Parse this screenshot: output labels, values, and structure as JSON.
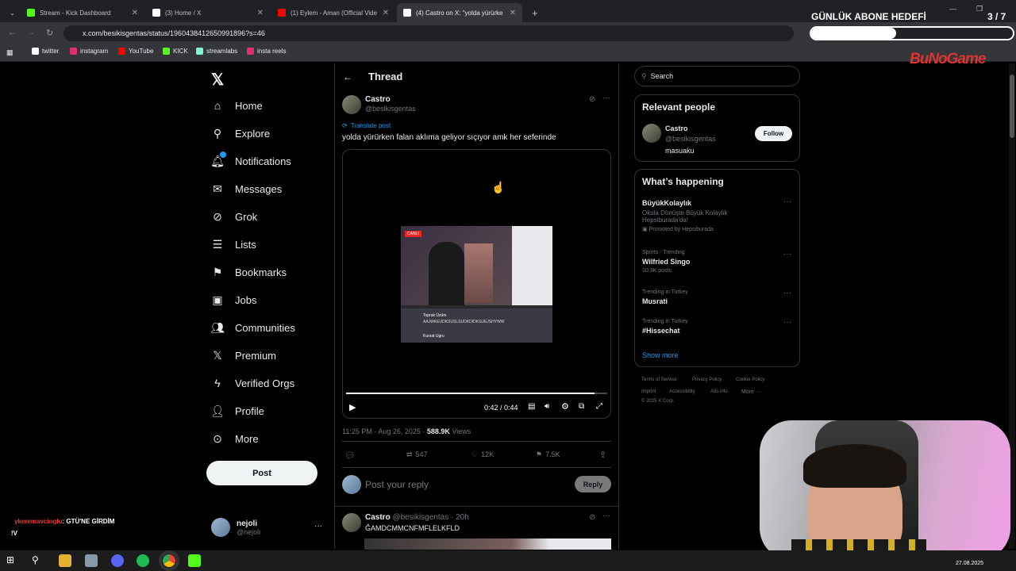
{
  "browser": {
    "tabs": [
      {
        "title": "Stream - Kick Dashboard",
        "color": "#53fc18"
      },
      {
        "title": "(3) Home / X",
        "color": "#ffffff"
      },
      {
        "title": "(1) Eylem - Aman (Official Vide",
        "color": "#ff0000"
      },
      {
        "title": "(4) Castro on X: \"yolda yürürke",
        "color": "#ffffff"
      }
    ],
    "url": "x.com/besikisgentas/status/1960438412650991896?s=46",
    "bookmarks": [
      "twitter",
      "instagram",
      "YouTube",
      "KICK",
      "streamlabs",
      "insta reels"
    ]
  },
  "overlay": {
    "goal_title": "GÜNLÜK ABONE HEDEFİ",
    "goal_count": "3 / 7",
    "brand": "BuNoGame",
    "chat_user": "ykeremavcioglu",
    "chat_text": ": GTÜ'NE GİRDİM",
    "chat_text2": "!V"
  },
  "nav": {
    "items": [
      "Home",
      "Explore",
      "Notifications",
      "Messages",
      "Grok",
      "Lists",
      "Bookmarks",
      "Jobs",
      "Communities",
      "Premium",
      "Verified Orgs",
      "Profile",
      "More"
    ],
    "post_label": "Post",
    "user_name": "nejoli",
    "user_handle": "@nejoli"
  },
  "thread": {
    "header": "Thread",
    "author": "Castro",
    "handle": "@besikisgentas",
    "translate": "Translate post",
    "text": "yolda yürürken falan aklıma geliyor sıçıyor amk her seferinde",
    "video_time": "0:42 / 0:44",
    "video_progress": 0.95,
    "timestamp": "11:25 PM · Aug 26, 2025 · ",
    "views_count": "588.9K",
    "views_label": "Views",
    "retweets": "547",
    "likes": "12K",
    "bookmarks": "7.5K",
    "reply_placeholder": "Post your reply",
    "reply_btn": "Reply",
    "reply_author": "Castro",
    "reply_handle": "@besikisgentas · 20h",
    "reply_text": "ĞAMDCMMCNFMFLELKFLD",
    "inner_badge": "CANLI",
    "inner_comment_user": "Toprak Üzüm",
    "inner_comment_text": "AAJWKEUDKSUSLSUDKDIDKSUEJSHYWW",
    "inner_comment_user2": "Kursat Ugru"
  },
  "right": {
    "search_placeholder": "Search",
    "relevant_title": "Relevant people",
    "person": {
      "name": "Castro",
      "handle": "@besikisgentas",
      "bio": "masuaku",
      "follow": "Follow"
    },
    "happening_title": "What’s happening",
    "trends": [
      {
        "top": "BüyükKolaylık",
        "mid": "Okula Dönüşte Büyük Kolaylık Hepsiburada'da!",
        "bottom": "Promoted by Hepsiburada",
        "promo": true
      },
      {
        "top": "Sports · Trending",
        "mid": "Wilfried Singo",
        "bottom": "10.3K posts"
      },
      {
        "top": "Trending in Turkey",
        "mid": "Musrati",
        "bottom": ""
      },
      {
        "top": "Trending in Turkey",
        "mid": "#Hissechat",
        "bottom": ""
      }
    ],
    "show_more": "Show more",
    "footer": [
      "Terms of Service",
      "Privacy Policy",
      "Cookie Policy",
      "Imprint",
      "Accessibility",
      "Ads info",
      "More ···",
      "© 2025 X Corp."
    ]
  },
  "taskbar": {
    "date": "27.08.2025"
  }
}
